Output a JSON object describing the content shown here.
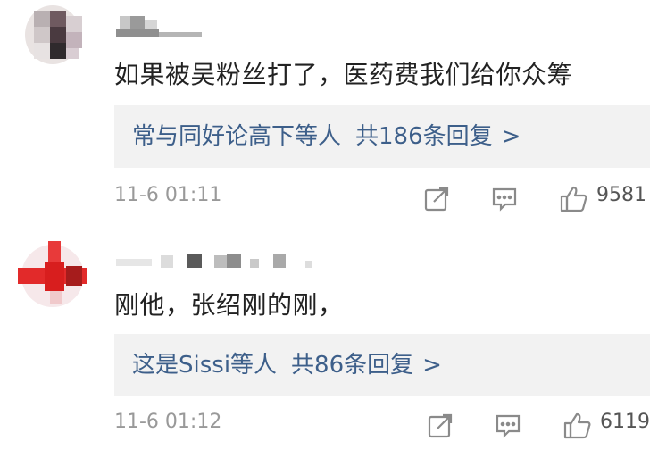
{
  "comments": [
    {
      "text": "如果被吴粉丝打了，医药费我们给你众筹",
      "reply_who": "常与同好论高下等人",
      "reply_count": "共186条回复",
      "reply_arrow": ">",
      "time": "11-6 01:11",
      "likes": "9581"
    },
    {
      "text": "刚他，张绍刚的刚，",
      "reply_who": "这是Sissi等人",
      "reply_count": "共86条回复",
      "reply_arrow": ">",
      "time": "11-6 01:12",
      "likes": "6119"
    }
  ],
  "icons": {
    "share": "share-icon",
    "comment": "comment-icon",
    "like": "thumbs-up-icon"
  },
  "colors": {
    "reply_link": "#3d5f8a",
    "reply_bg": "#f2f2f2",
    "meta_gray": "#999999"
  }
}
